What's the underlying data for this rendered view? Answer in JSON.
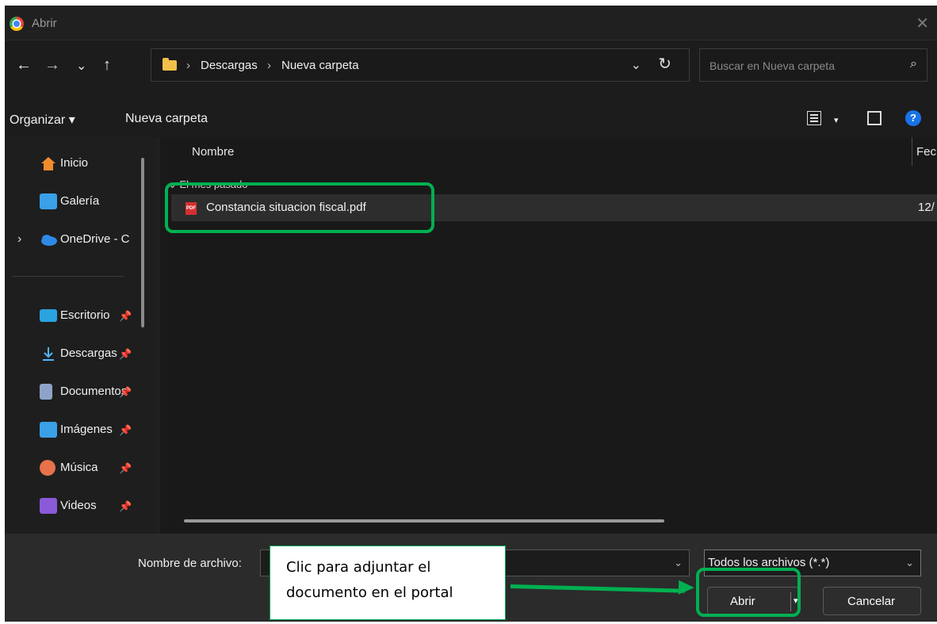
{
  "window": {
    "title": "Abrir",
    "close_glyph": "✕"
  },
  "nav": {
    "back": "←",
    "forward": "→",
    "recent": "⌄",
    "up": "↑",
    "dropdown": "⌄",
    "refresh": "↻"
  },
  "address": {
    "crumbs": [
      "Descargas",
      "Nueva carpeta"
    ],
    "separator": "›"
  },
  "search": {
    "placeholder": "Buscar en Nueva carpeta",
    "icon": "⌕"
  },
  "commands": {
    "organize": "Organizar ▾",
    "new_folder": "Nueva carpeta",
    "view_dd": "▾",
    "help": "?"
  },
  "sidebar": {
    "items": [
      {
        "label": "Inicio",
        "icon": "home-icon",
        "color": "#f08c2e"
      },
      {
        "label": "Galería",
        "icon": "gallery-icon",
        "color": "#3aa0e8"
      },
      {
        "label": "OneDrive - C",
        "icon": "onedrive-icon",
        "color": "#2f8ae6",
        "expand": "›"
      },
      {
        "label": "Escritorio",
        "icon": "desktop-icon",
        "color": "#2aa3e0",
        "pin": "📌"
      },
      {
        "label": "Descargas",
        "icon": "download-icon",
        "color": "#4fb6ff",
        "pin": "📌"
      },
      {
        "label": "Documentos",
        "icon": "documents-icon",
        "color": "#8fa3c8",
        "pin": "📌"
      },
      {
        "label": "Imágenes",
        "icon": "pictures-icon",
        "color": "#3aa0e8",
        "pin": "📌"
      },
      {
        "label": "Música",
        "icon": "music-icon",
        "color": "#e8724a",
        "pin": "📌"
      },
      {
        "label": "Videos",
        "icon": "videos-icon",
        "color": "#8a5ad8",
        "pin": "📌"
      }
    ]
  },
  "list": {
    "column_name": "Nombre",
    "column_date": "Fec",
    "group": "⌄ El mes pasado",
    "rows": [
      {
        "name": "Constancia situacion fiscal.pdf",
        "date": "12/",
        "icon_label": "PDF"
      }
    ]
  },
  "bottom": {
    "filename_label": "Nombre de archivo:",
    "filter_value": "Todos los archivos (*.*)",
    "open_label": "Abrir",
    "cancel_label": "Cancelar"
  },
  "annotation": {
    "line1": "Clic para adjuntar el",
    "line2": "documento en el portal",
    "color": "#00b050"
  }
}
